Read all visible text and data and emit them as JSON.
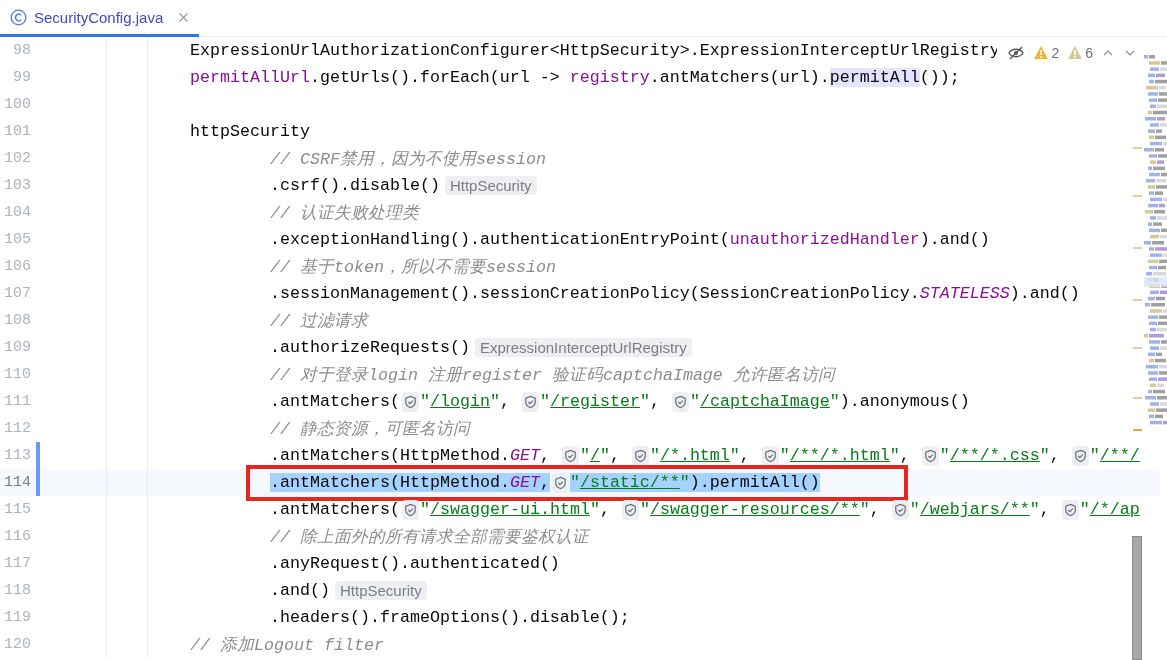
{
  "tab": {
    "title": "SecurityConfig.java",
    "selected": true
  },
  "inspections": [
    {
      "kind": "warning",
      "count": "2"
    },
    {
      "kind": "weak",
      "count": "6"
    }
  ],
  "lines": [
    {
      "number": "98",
      "kind": "statement",
      "segments": [
        {
          "kind": "plain",
          "text": "ExpressionUrlAuthorizationConfigurer<HttpSecurity>.ExpressionInterceptUrlRegistry"
        }
      ]
    },
    {
      "number": "99",
      "kind": "statement",
      "segments": [
        {
          "kind": "field",
          "text": "permitAllUrl"
        },
        {
          "kind": "plain",
          "text": ".getUrls().forEach(url -> "
        },
        {
          "kind": "field",
          "text": "registry"
        },
        {
          "kind": "plain",
          "text": ".antMatchers(url)."
        },
        {
          "kind": "usage",
          "text": "permitAll"
        },
        {
          "kind": "plain",
          "text": "());"
        }
      ]
    },
    {
      "number": "100",
      "kind": "blank"
    },
    {
      "number": "101",
      "kind": "statement",
      "segments": [
        {
          "kind": "plain",
          "text": "httpSecurity"
        }
      ]
    },
    {
      "number": "102",
      "kind": "chain",
      "segments": [
        {
          "kind": "comment",
          "text": "// CSRF禁用，因为不使用session"
        }
      ]
    },
    {
      "number": "103",
      "kind": "chain",
      "segments": [
        {
          "kind": "plain",
          "text": ".csrf().disable()"
        },
        {
          "kind": "hint",
          "text": "HttpSecurity"
        }
      ]
    },
    {
      "number": "104",
      "kind": "chain",
      "segments": [
        {
          "kind": "comment",
          "text": "// 认证失败处理类"
        }
      ]
    },
    {
      "number": "105",
      "kind": "chain",
      "segments": [
        {
          "kind": "plain",
          "text": ".exceptionHandling().authenticationEntryPoint("
        },
        {
          "kind": "field",
          "text": "unauthorizedHandler"
        },
        {
          "kind": "plain",
          "text": ").and()"
        }
      ]
    },
    {
      "number": "106",
      "kind": "chain",
      "segments": [
        {
          "kind": "comment",
          "text": "// 基于token，所以不需要session"
        }
      ]
    },
    {
      "number": "107",
      "kind": "chain",
      "segments": [
        {
          "kind": "plain",
          "text": ".sessionManagement().sessionCreationPolicy(SessionCreationPolicy."
        },
        {
          "kind": "static",
          "text": "STATELESS"
        },
        {
          "kind": "plain",
          "text": ").and()"
        }
      ]
    },
    {
      "number": "108",
      "kind": "chain",
      "segments": [
        {
          "kind": "comment",
          "text": "// 过滤请求"
        }
      ]
    },
    {
      "number": "109",
      "kind": "chain",
      "segments": [
        {
          "kind": "plain",
          "text": ".authorizeRequests()"
        },
        {
          "kind": "hint",
          "text": "ExpressionInterceptUrlRegistry"
        }
      ]
    },
    {
      "number": "110",
      "kind": "chain",
      "segments": [
        {
          "kind": "comment",
          "text": "// 对于登录login 注册register 验证码captchaImage 允许匿名访问"
        }
      ]
    },
    {
      "number": "111",
      "kind": "chain",
      "segments": [
        {
          "kind": "plain",
          "text": ".antMatchers("
        },
        {
          "kind": "shield"
        },
        {
          "kind": "string",
          "text": "\""
        },
        {
          "kind": "url",
          "text": "/login"
        },
        {
          "kind": "string",
          "text": "\""
        },
        {
          "kind": "plain",
          "text": ", "
        },
        {
          "kind": "shield"
        },
        {
          "kind": "string",
          "text": "\""
        },
        {
          "kind": "url",
          "text": "/register"
        },
        {
          "kind": "string",
          "text": "\""
        },
        {
          "kind": "plain",
          "text": ", "
        },
        {
          "kind": "shield"
        },
        {
          "kind": "string",
          "text": "\""
        },
        {
          "kind": "url",
          "text": "/captchaImage"
        },
        {
          "kind": "string",
          "text": "\""
        },
        {
          "kind": "plain",
          "text": ").anonymous()"
        }
      ]
    },
    {
      "number": "112",
      "kind": "chain",
      "segments": [
        {
          "kind": "comment",
          "text": "// 静态资源，可匿名访问"
        }
      ]
    },
    {
      "number": "113",
      "kind": "chain",
      "changed": true,
      "segments": [
        {
          "kind": "plain",
          "text": ".antMatchers(HttpMethod."
        },
        {
          "kind": "static",
          "text": "GET"
        },
        {
          "kind": "plain",
          "text": ", "
        },
        {
          "kind": "shield"
        },
        {
          "kind": "string",
          "text": "\""
        },
        {
          "kind": "url",
          "text": "/"
        },
        {
          "kind": "string",
          "text": "\""
        },
        {
          "kind": "plain",
          "text": ", "
        },
        {
          "kind": "shield"
        },
        {
          "kind": "string",
          "text": "\""
        },
        {
          "kind": "url",
          "text": "/*.html"
        },
        {
          "kind": "string",
          "text": "\""
        },
        {
          "kind": "plain",
          "text": ", "
        },
        {
          "kind": "shield"
        },
        {
          "kind": "string",
          "text": "\""
        },
        {
          "kind": "url",
          "text": "/**/*.html"
        },
        {
          "kind": "string",
          "text": "\""
        },
        {
          "kind": "plain",
          "text": ", "
        },
        {
          "kind": "shield"
        },
        {
          "kind": "string",
          "text": "\""
        },
        {
          "kind": "url",
          "text": "/**/*.css"
        },
        {
          "kind": "string",
          "text": "\""
        },
        {
          "kind": "plain",
          "text": ", "
        },
        {
          "kind": "shield"
        },
        {
          "kind": "string",
          "text": "\""
        },
        {
          "kind": "url",
          "text": "/**/"
        }
      ]
    },
    {
      "number": "114",
      "kind": "chain",
      "changed": true,
      "current": true,
      "selected": true,
      "marked": true,
      "segments": [
        {
          "kind": "plain",
          "text": ".antMatchers(HttpMethod."
        },
        {
          "kind": "static",
          "text": "GET"
        },
        {
          "kind": "plain",
          "text": ","
        },
        {
          "kind": "shield"
        },
        {
          "kind": "string",
          "text": "\""
        },
        {
          "kind": "url",
          "text": "/static/**"
        },
        {
          "kind": "string",
          "text": "\""
        },
        {
          "kind": "plain",
          "text": ").permitAll()"
        }
      ]
    },
    {
      "number": "115",
      "kind": "chain",
      "segments": [
        {
          "kind": "plain",
          "text": ".antMatchers("
        },
        {
          "kind": "shield"
        },
        {
          "kind": "string",
          "text": "\""
        },
        {
          "kind": "url",
          "text": "/swagger-ui.html"
        },
        {
          "kind": "string",
          "text": "\""
        },
        {
          "kind": "plain",
          "text": ", "
        },
        {
          "kind": "shield"
        },
        {
          "kind": "string",
          "text": "\""
        },
        {
          "kind": "url",
          "text": "/swagger-resources/**"
        },
        {
          "kind": "string",
          "text": "\""
        },
        {
          "kind": "plain",
          "text": ", "
        },
        {
          "kind": "shield"
        },
        {
          "kind": "string",
          "text": "\""
        },
        {
          "kind": "url",
          "text": "/webjars/**"
        },
        {
          "kind": "string",
          "text": "\""
        },
        {
          "kind": "plain",
          "text": ", "
        },
        {
          "kind": "shield"
        },
        {
          "kind": "string",
          "text": "\""
        },
        {
          "kind": "url",
          "text": "/*/ap"
        }
      ]
    },
    {
      "number": "116",
      "kind": "chain",
      "segments": [
        {
          "kind": "comment",
          "text": "// 除上面外的所有请求全部需要鉴权认证"
        }
      ]
    },
    {
      "number": "117",
      "kind": "chain",
      "segments": [
        {
          "kind": "plain",
          "text": ".anyRequest().authenticated()"
        }
      ]
    },
    {
      "number": "118",
      "kind": "chain",
      "segments": [
        {
          "kind": "plain",
          "text": ".and()"
        },
        {
          "kind": "hint",
          "text": "HttpSecurity"
        }
      ]
    },
    {
      "number": "119",
      "kind": "chain",
      "segments": [
        {
          "kind": "plain",
          "text": ".headers().frameOptions().disable();"
        }
      ]
    },
    {
      "number": "120",
      "kind": "statement",
      "segments": [
        {
          "kind": "comment",
          "text": "// 添加Logout filter"
        }
      ]
    }
  ]
}
